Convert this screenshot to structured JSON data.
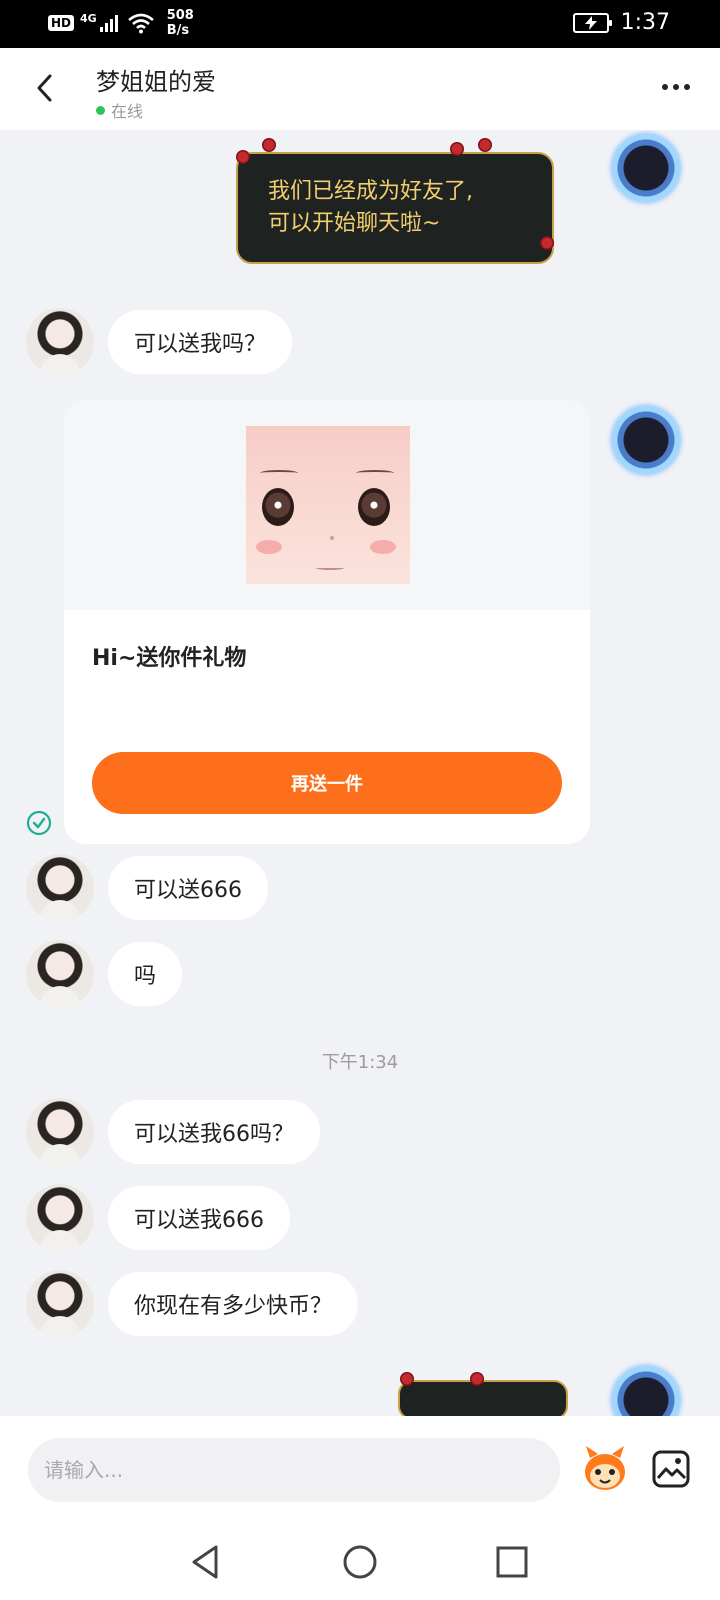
{
  "status_bar": {
    "hd": "HD",
    "network": "4G",
    "speed_value": "508",
    "speed_unit": "B/s",
    "time": "1:37"
  },
  "header": {
    "title": "梦姐姐的爱",
    "status": "在线"
  },
  "system_card": {
    "line1": "我们已经成为好友了,",
    "line2": "可以开始聊天啦~"
  },
  "messages": [
    {
      "text": "可以送我吗？"
    },
    {
      "text": "可以送666"
    },
    {
      "text": "吗"
    },
    {
      "text": "可以送我66吗？"
    },
    {
      "text": "可以送我666"
    },
    {
      "text": "你现在有多少快币？"
    }
  ],
  "gift_card": {
    "text": "Hi~送你件礼物",
    "button": "再送一件"
  },
  "timestamp": "下午1:34",
  "input": {
    "placeholder": "请输入..."
  },
  "colors": {
    "accent": "#fd6f1a",
    "online": "#2fc45b",
    "background": "#f0f2f6"
  }
}
